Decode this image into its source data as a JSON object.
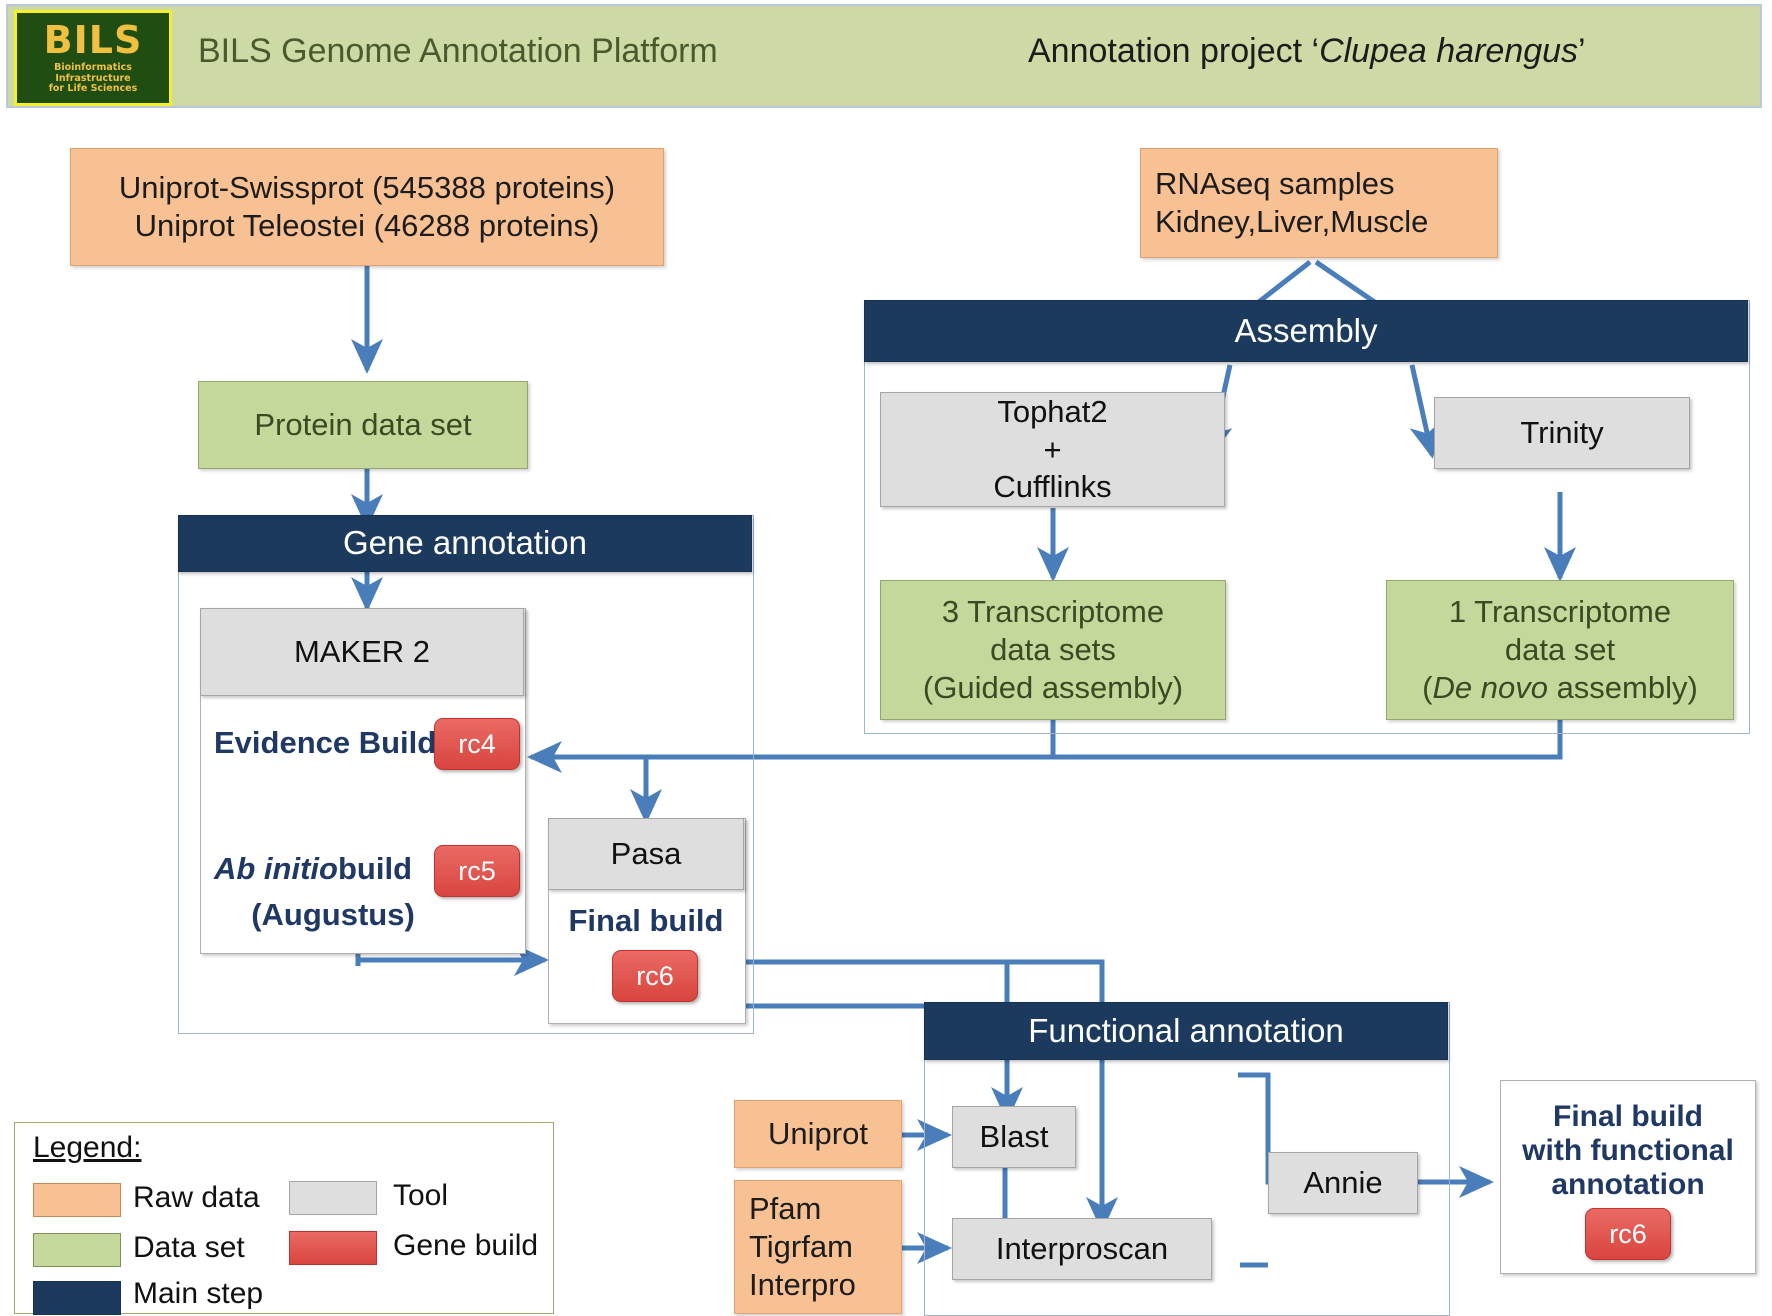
{
  "header": {
    "logo": {
      "name": "BILS",
      "tagline_lines": [
        "Bioinformatics",
        "Infrastructure",
        "for Life Sciences"
      ]
    },
    "platform_title": "BILS Genome Annotation Platform",
    "project_prefix": "Annotation project ‘",
    "project_species": "Clupea harengus",
    "project_suffix": "’"
  },
  "nodes": {
    "uniprot_raw": {
      "line1": "Uniprot-Swissprot (545388 proteins)",
      "line2": "Uniprot Teleostei (46288 proteins)"
    },
    "rnaseq_raw": {
      "line1": "RNAseq samples",
      "line2": "Kidney,Liver,Muscle"
    },
    "protein_dataset": "Protein data set",
    "assembly_step": "Assembly",
    "tophat": {
      "line1": "Tophat2",
      "line2": "+",
      "line3": "Cufflinks"
    },
    "trinity": "Trinity",
    "transcriptome_guided": {
      "line1": "3 Transcriptome",
      "line2": "data sets",
      "line3": "(Guided assembly)"
    },
    "transcriptome_denovo": {
      "line1": "1 Transcriptome",
      "line2": "data set",
      "line3_italic": "De novo",
      "line3_rest": " assembly)",
      "line3_open": "("
    },
    "gene_annotation_step": "Gene annotation",
    "maker": "MAKER 2",
    "evidence_build": "Evidence Build",
    "evidence_build_tag": "rc4",
    "abinitio_italic": "Ab initio",
    "abinitio_rest": " build",
    "abinitio_sub": "(Augustus)",
    "abinitio_tag": "rc5",
    "pasa": "Pasa",
    "final_build": "Final build",
    "final_build_tag": "rc6",
    "functional_annotation_step": "Functional annotation",
    "uniprot_fa": "Uniprot",
    "pfam_block": {
      "line1": "Pfam",
      "line2": "Tigrfam",
      "line3": "Interpro"
    },
    "blast": "Blast",
    "interproscan": "Interproscan",
    "annie": "Annie",
    "final_functional": {
      "line1": "Final build",
      "line2": "with functional",
      "line3": "annotation",
      "tag": "rc6"
    }
  },
  "legend": {
    "title": "Legend:",
    "items": [
      {
        "label": "Raw data",
        "color": "#f8c193"
      },
      {
        "label": "Data set",
        "color": "#c5d89b"
      },
      {
        "label": "Main step",
        "color": "#1b3a5e"
      },
      {
        "label": "Tool",
        "color": "#dedede"
      },
      {
        "label": "Gene build",
        "color": "#e8544e"
      }
    ]
  },
  "colors": {
    "raw_data": "#f8c193",
    "data_set": "#c5d89b",
    "main_step": "#1b3a5e",
    "tool": "#dedede",
    "gene_build": "#e8544e",
    "arrow": "#4a7ebb",
    "header_bg": "#cddaa5"
  }
}
